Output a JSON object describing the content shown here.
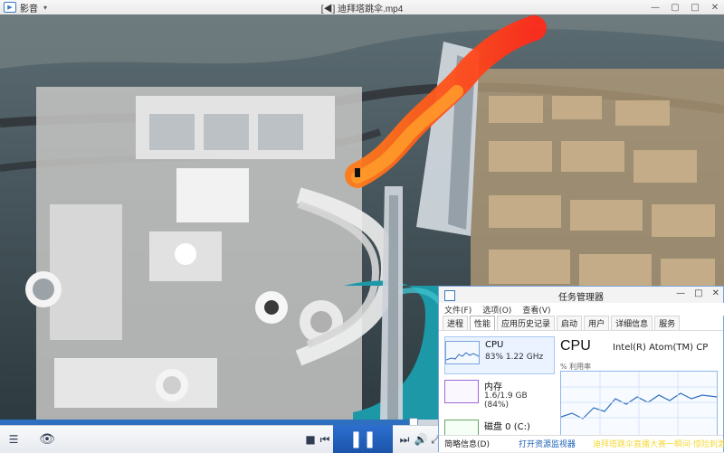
{
  "titlebar": {
    "app_name": "影音",
    "file_title": "[◀] 迪拜塔跳伞.mp4",
    "controls": [
      "minimize-icon",
      "restore-icon",
      "maximize-icon",
      "close-icon"
    ]
  },
  "player": {
    "progress_percent": 57,
    "play_button": "pause-icon"
  },
  "task_manager": {
    "title": "任务管理器",
    "menu": [
      "文件(F)",
      "选项(O)",
      "查看(V)"
    ],
    "tabs": [
      "进程",
      "性能",
      "应用历史记录",
      "启动",
      "用户",
      "详细信息",
      "服务"
    ],
    "active_tab": "性能",
    "resources": [
      {
        "name": "CPU",
        "sub": "83%  1.22 GHz"
      },
      {
        "name": "内存",
        "sub": "1.6/1.9 GB (84%)"
      },
      {
        "name": "磁盘 0 (C:)",
        "sub": ""
      }
    ],
    "cpu_panel": {
      "heading": "CPU",
      "model": "Intel(R) Atom(TM) CP",
      "utilization_label": "% 利用率"
    },
    "footer": {
      "fewer_details": "简略信息(D)",
      "open_resource_monitor": "打开资源监视器",
      "marquee": "迪拜塔跳伞直播大赛一瞬间·惊险刺激"
    }
  },
  "colors": {
    "accent_blue": "#2f6fbf",
    "tm_border": "#7aa4da",
    "marquee_yellow": "#f4d93a"
  }
}
